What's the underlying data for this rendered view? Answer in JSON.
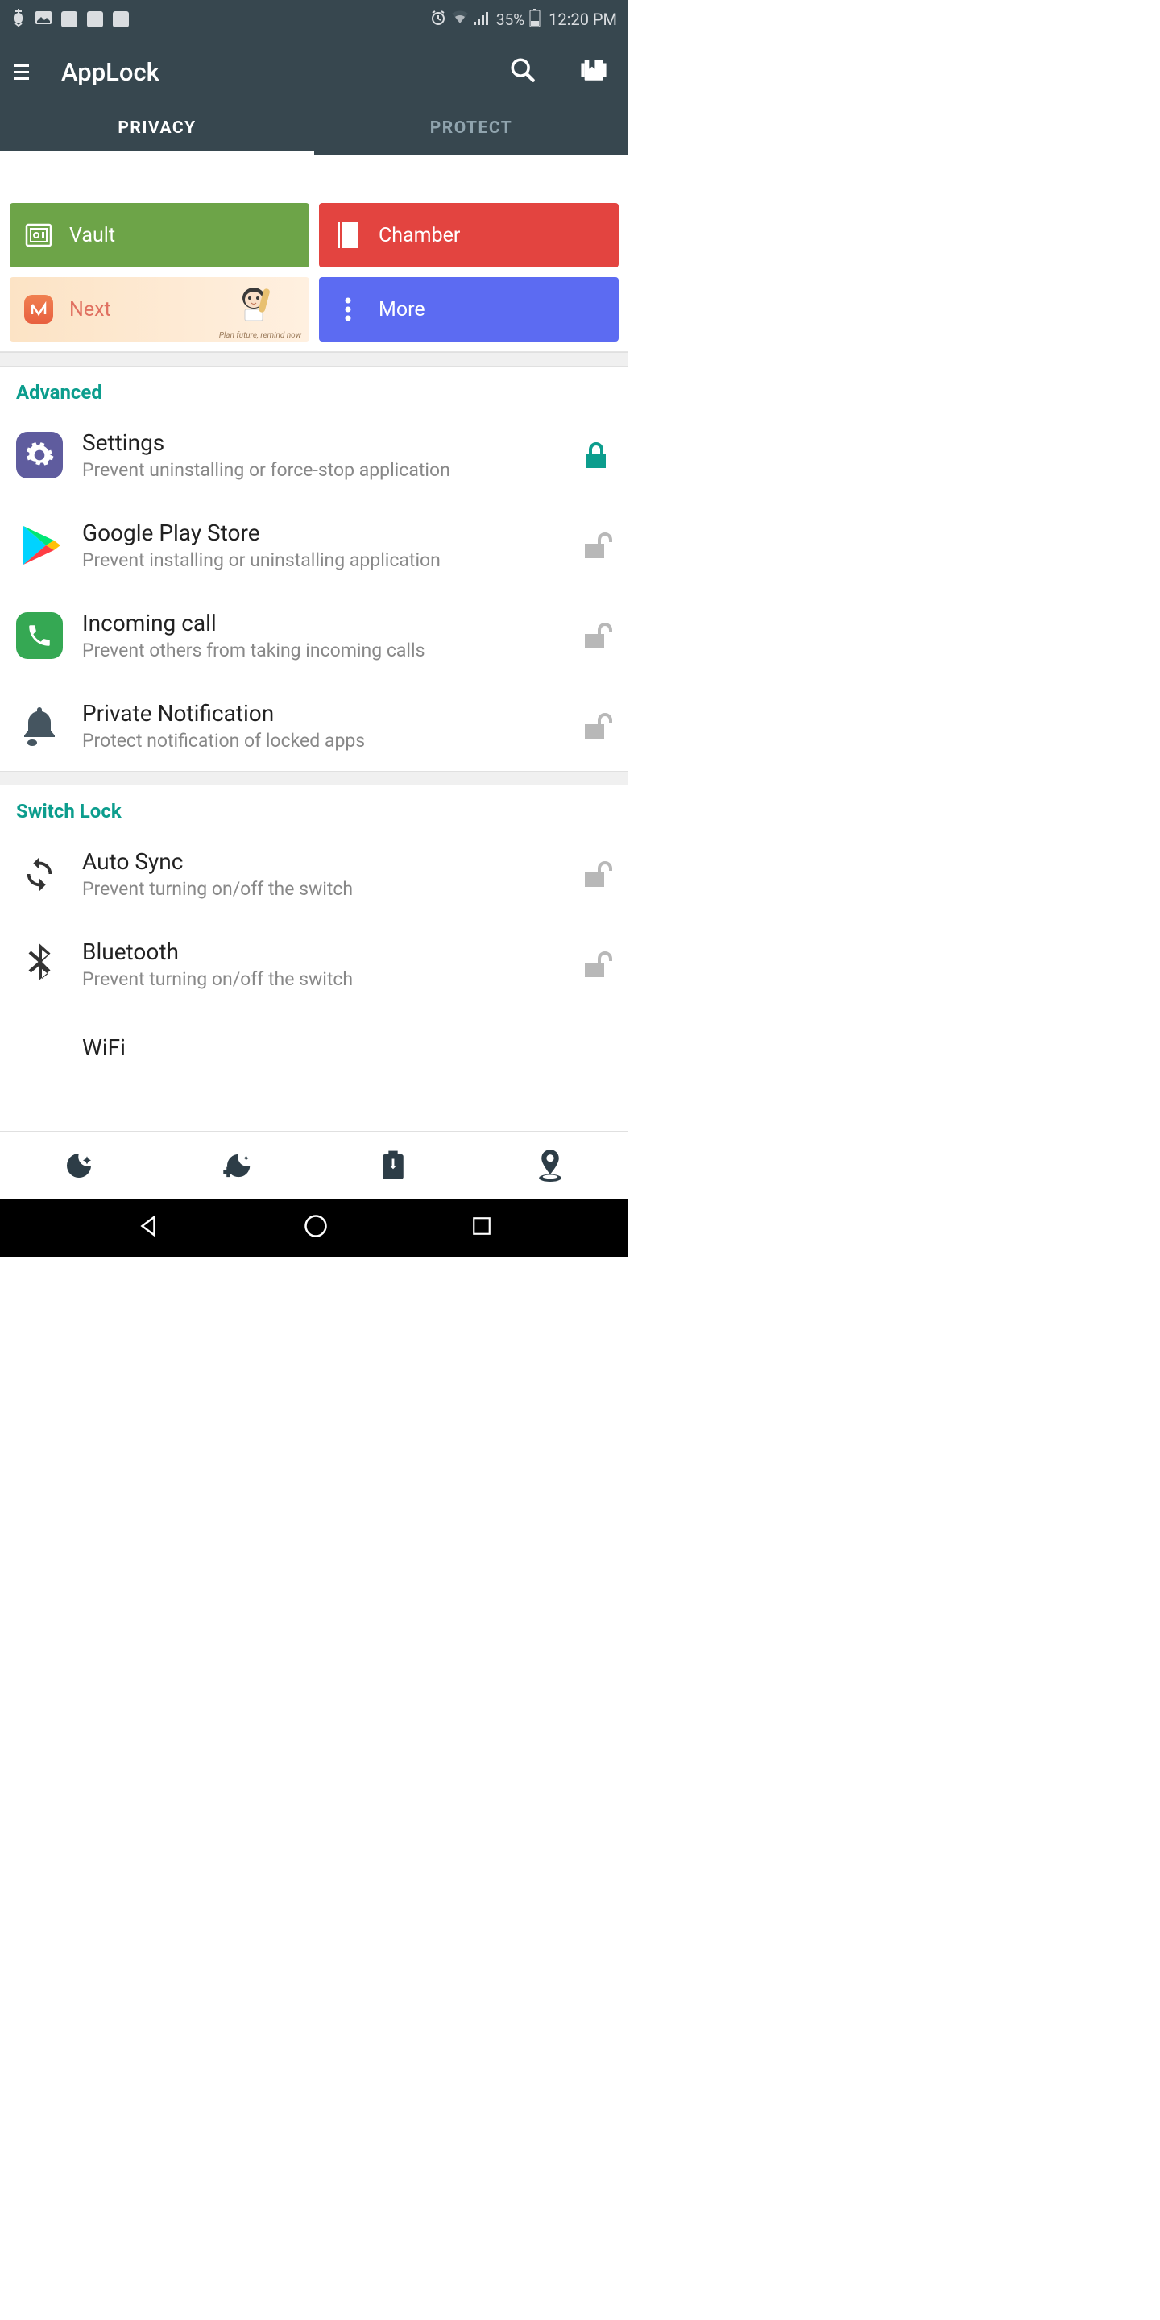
{
  "status": {
    "battery": "35%",
    "time": "12:20 PM"
  },
  "app": {
    "title": "AppLock"
  },
  "tabs": {
    "privacy": "PRIVACY",
    "protect": "PROTECT"
  },
  "cards": {
    "vault": "Vault",
    "chamber": "Chamber",
    "next": "Next",
    "next_tagline": "Plan future, remind now",
    "more": "More"
  },
  "sections": {
    "advanced": {
      "header": "Advanced",
      "items": [
        {
          "title": "Settings",
          "sub": "Prevent uninstalling or force-stop application",
          "locked": true
        },
        {
          "title": "Google Play Store",
          "sub": "Prevent installing or uninstalling application",
          "locked": false
        },
        {
          "title": "Incoming call",
          "sub": "Prevent others from taking incoming calls",
          "locked": false
        },
        {
          "title": "Private Notification",
          "sub": "Protect notification of locked apps",
          "locked": false
        }
      ]
    },
    "switch": {
      "header": "Switch Lock",
      "items": [
        {
          "title": "Auto Sync",
          "sub": "Prevent turning on/off the switch",
          "locked": false
        },
        {
          "title": "Bluetooth",
          "sub": "Prevent turning on/off the switch",
          "locked": false
        },
        {
          "title": "WiFi",
          "sub": "",
          "locked": false
        }
      ]
    }
  }
}
